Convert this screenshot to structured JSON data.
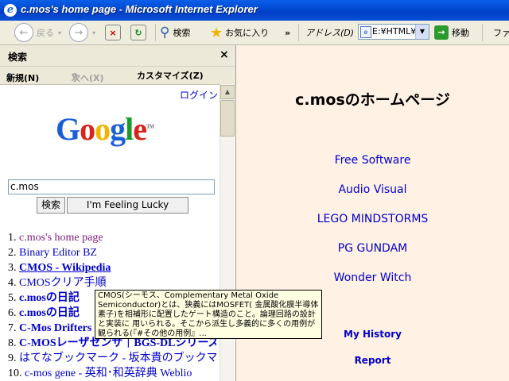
{
  "window": {
    "title": "c.mos's home page - Microsoft Internet Explorer"
  },
  "toolbar": {
    "back": "戻る",
    "search": "検索",
    "favorites": "お気に入り",
    "address_label": "アドレス(D)",
    "address_value": "E:¥HTML¥",
    "go": "移動",
    "more": "ファ"
  },
  "search_pane": {
    "title": "検索",
    "close": "×",
    "tools": {
      "new": "新規(N)",
      "next": "次へ(X)",
      "customize": "カスタマイズ(Z)"
    },
    "login": "ログイン",
    "logo": "Google",
    "query": "c.mos",
    "search_button": "検索",
    "lucky_button": "I'm Feeling Lucky",
    "results": [
      {
        "num": "1.",
        "text": "c.mos's home page"
      },
      {
        "num": "2.",
        "text": "Binary Editor BZ"
      },
      {
        "num": "3.",
        "text": "CMOS - Wikipedia"
      },
      {
        "num": "4.",
        "text": "CMOSクリア手順"
      },
      {
        "num": "5.",
        "text": "c.mosの日記"
      },
      {
        "num": "6.",
        "text": "c.mosの日記"
      },
      {
        "num": "7.",
        "text": "C-Mos Drifters"
      },
      {
        "num": "8.",
        "text": "C-MOSレーザセンサ｜BGS-DLシリーズ"
      },
      {
        "num": "9.",
        "text": "はてなブックマーク - 坂本貴のブックマーク"
      },
      {
        "num": "10.",
        "text": "c-mos gene - 英和･和英辞典 Weblio"
      }
    ],
    "tooltip": "CMOS(シーモス、Complementary Metal Oxide Semiconductor)とは、狭義にはMOSFET( 金属酸化膜半導体素子)を相補形に配置したゲート構造のこと。論理回路の設計と実装に 用いられる。そこから派生し多義的に多くの用例が観られる(『#その他の用例』..."
  },
  "page": {
    "heading": "c.mosのホームページ",
    "links": [
      "Free Software",
      "Audio Visual",
      "LEGO MINDSTORMS",
      "PG GUNDAM",
      "Wonder Witch"
    ],
    "small_links": [
      "My History",
      "Report"
    ]
  },
  "colors": {
    "titlebar": "#0a4fd8",
    "content_bg": "#fff1e4",
    "link": "#0000cc",
    "visited": "#7a1a7a"
  }
}
